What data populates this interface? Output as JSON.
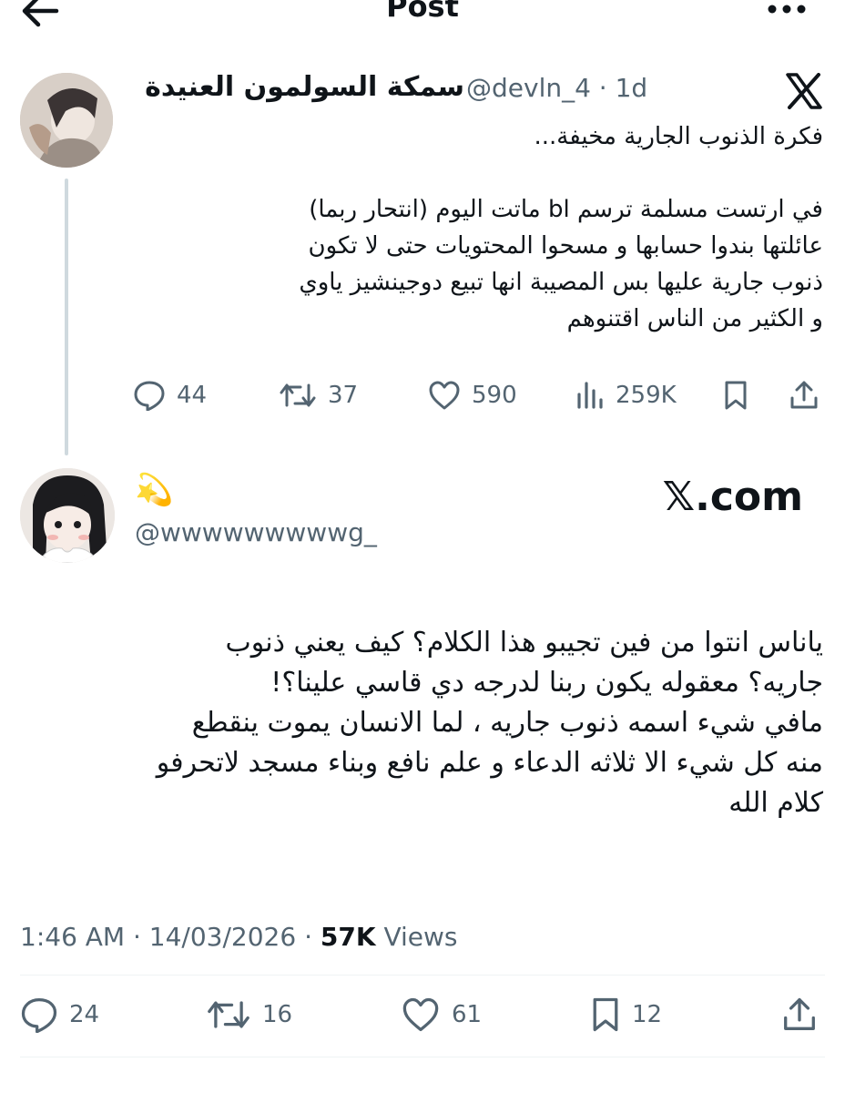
{
  "header": {
    "title": "Post",
    "back_icon": "arrow-left-icon",
    "more_icon": "more-horizontal-icon"
  },
  "quoted_tweet": {
    "display_name": "سمكة السولمون العنيدة",
    "handle_time": "@devln_4 · 1d",
    "platform_icon": "x-logo-icon",
    "text_line1": "فكرة الذنوب الجارية مخيفة...",
    "text_lines": [
      "في ارتست مسلمة ترسم bl ماتت اليوم (انتحار ربما)",
      "عائلتها بندوا حسابها و مسحوا المحتويات حتى لا تكون",
      "ذنوب جارية عليها بس المصيبة انها تبيع دوجينشيز ياوي",
      "و الكثير من الناس اقتنوهم"
    ],
    "stats": {
      "replies": "44",
      "reposts": "37",
      "likes": "590",
      "views": "259K"
    }
  },
  "main_tweet": {
    "emoji": "💫",
    "handle": "@wwwwwwwwwg_",
    "watermark": "𝕏.com",
    "text_lines": [
      "ياناس انتوا من فين تجيبو هذا الكلام؟ كيف يعني ذنوب",
      "جاريه؟ معقوله يكون ربنا لدرجه دي قاسي علينا؟!",
      "مافي شيء اسمه ذنوب جاريه ، لما الانسان يموت ينقطع",
      "منه كل شيء الا ثلاثه الدعاء و علم نافع وبناء مسجد لاتحرفو",
      "كلام الله"
    ],
    "time": "1:46 AM · 14/03/2026 · ",
    "views_count": "57K",
    "views_label": " Views",
    "stats": {
      "replies": "24",
      "reposts": "16",
      "likes": "61",
      "bookmarks": "12"
    }
  },
  "colors": {
    "text": "#0f1419",
    "secondary": "#536471",
    "divider": "#eff3f4",
    "thread_line": "#cfd9de"
  }
}
